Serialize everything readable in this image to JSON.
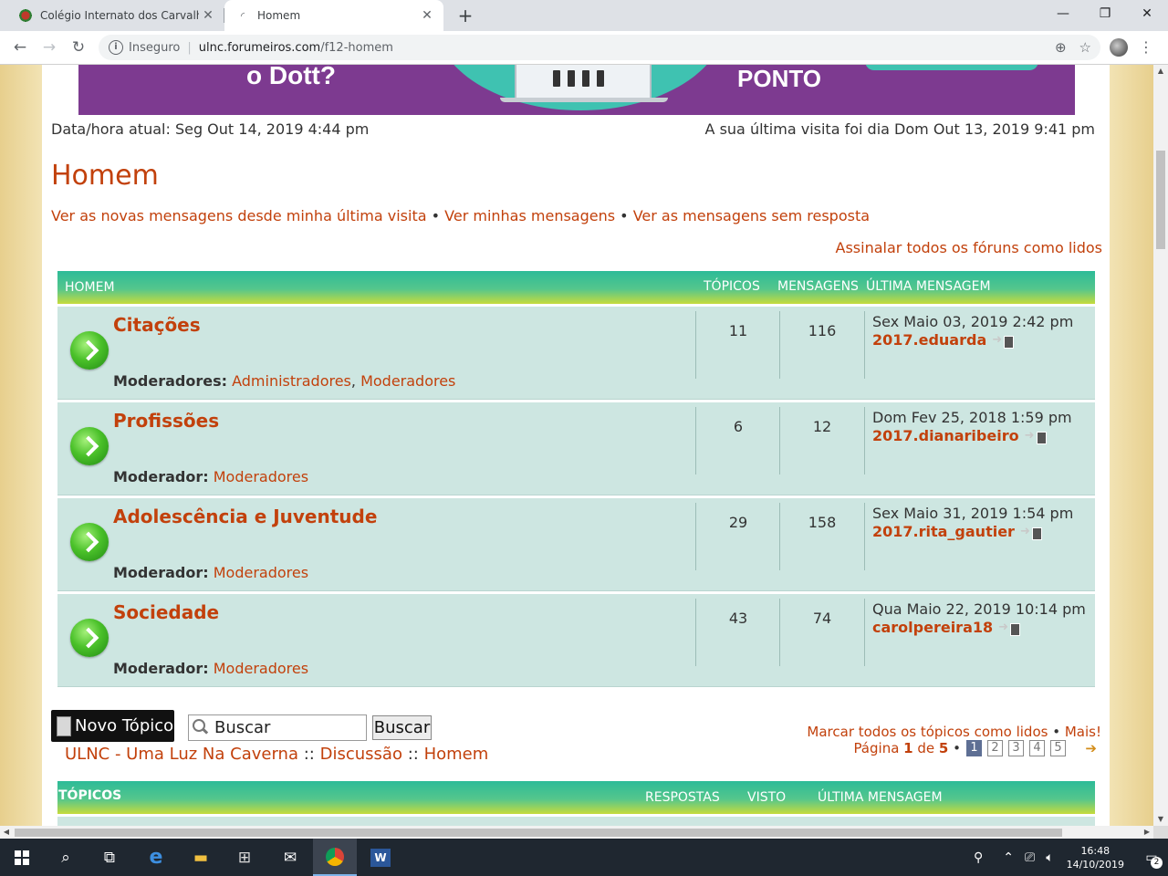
{
  "browser": {
    "tabs": [
      {
        "title": "Colégio Internato dos Carvalhos"
      },
      {
        "title": "Homem"
      }
    ],
    "new_tab_symbol": "+",
    "insecure_label": "Inseguro",
    "url_host": "ulnc.forumeiros.com",
    "url_path": "/f12-homem"
  },
  "banner": {
    "left_text": "o Dott?",
    "right_text": "PONTO"
  },
  "header": {
    "current_date": "Data/hora atual: Seg Out 14, 2019 4:44 pm",
    "last_visit": "A sua última visita foi dia Dom Out 13, 2019 9:41 pm",
    "title": "Homem",
    "links": {
      "new_posts": "Ver as novas mensagens desde minha última visita",
      "my_posts": "Ver minhas mensagens",
      "unanswered": "Ver as mensagens sem resposta",
      "separator": "•"
    },
    "mark_all_forums": "Assinalar todos os fóruns como lidos"
  },
  "forum_table": {
    "headers": {
      "forum": "HOMEM",
      "topics": "TÓPICOS",
      "posts": "MENSAGENS",
      "last_post": "ÚLTIMA MENSAGEM"
    },
    "rows": [
      {
        "title": "Citações",
        "moderator_label": "Moderadores:",
        "moderators": [
          "Administradores",
          "Moderadores"
        ],
        "topics": "11",
        "posts": "116",
        "last_date": "Sex Maio 03, 2019 2:42 pm",
        "last_user": "2017.eduarda"
      },
      {
        "title": "Profissões",
        "moderator_label": "Moderador:",
        "moderators": [
          "Moderadores"
        ],
        "topics": "6",
        "posts": "12",
        "last_date": "Dom Fev 25, 2018 1:59 pm",
        "last_user": "2017.dianaribeiro"
      },
      {
        "title": "Adolescência e Juventude",
        "moderator_label": "Moderador:",
        "moderators": [
          "Moderadores"
        ],
        "topics": "29",
        "posts": "158",
        "last_date": "Sex Maio 31, 2019 1:54 pm",
        "last_user": "2017.rita_gautier"
      },
      {
        "title": "Sociedade",
        "moderator_label": "Moderador:",
        "moderators": [
          "Moderadores"
        ],
        "topics": "43",
        "posts": "74",
        "last_date": "Qua Maio 22, 2019 10:14 pm",
        "last_user": "carolpereira18"
      }
    ]
  },
  "actions": {
    "new_topic": "Novo Tópico",
    "search_value": "Buscar",
    "search_button": "Buscar",
    "breadcrumb": [
      "ULNC - Uma Luz Na Caverna",
      "Discussão",
      "Homem"
    ],
    "breadcrumb_sep": "::",
    "mark_topics": "Marcar todos os tópicos como lidos",
    "more": "Mais!",
    "page_label": "Página",
    "page_current": "1",
    "page_of": "de",
    "page_total": "5",
    "pages": [
      "1",
      "2",
      "3",
      "4",
      "5"
    ]
  },
  "topics_table": {
    "headers": {
      "topics": "TÓPICOS",
      "replies": "RESPOSTAS",
      "views": "VISTO",
      "last_post": "ÚLTIMA MENSAGEM"
    }
  },
  "taskbar": {
    "time": "16:48",
    "date": "14/10/2019",
    "notifications": "2"
  },
  "colors": {
    "link": "#c2410c",
    "row_bg": "#cde6e1",
    "header_gradient_start": "#2dbb98",
    "header_gradient_end": "#c7db3c"
  }
}
